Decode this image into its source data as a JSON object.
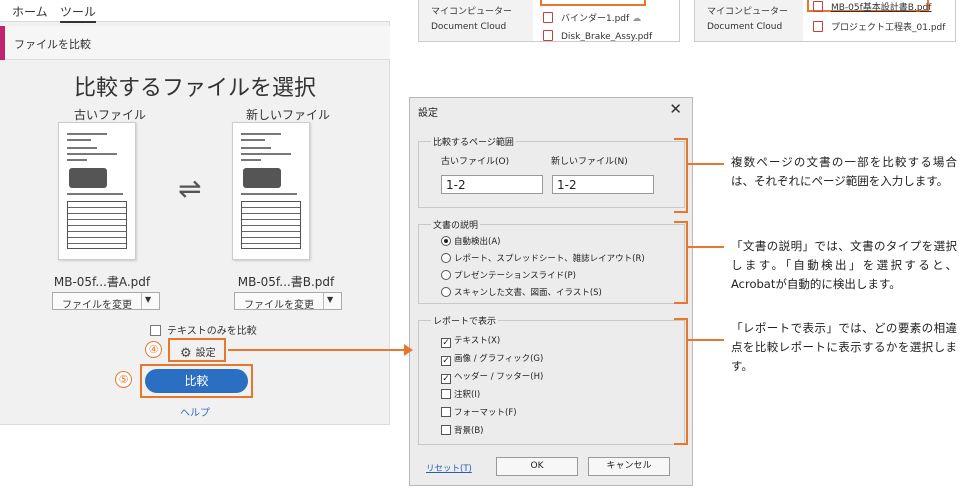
{
  "top_tabs": {
    "home": "ホーム",
    "tools": "ツール"
  },
  "tool_header": {
    "title": "ファイルを比較",
    "accent_color": "#c1246e"
  },
  "compare_panel": {
    "title": "比較するファイルを選択",
    "old_file": {
      "label": "古いファイル",
      "name": "MB-05f...書A.pdf",
      "change_button": "ファイルを変更"
    },
    "new_file": {
      "label": "新しいファイル",
      "name": "MB-05f...書B.pdf",
      "change_button": "ファイルを変更"
    },
    "swap_glyph": "⇌",
    "text_only_checkbox": "テキストのみを比較",
    "settings_button": "設定",
    "compare_button": "比較",
    "help_link": "ヘルプ",
    "step_numbers": [
      "④",
      "⑤"
    ],
    "button_color": "#2a6fc1",
    "highlight_color": "#e8772e"
  },
  "snippet_left": {
    "nav_items": [
      "マイコンピューター",
      "Document Cloud"
    ],
    "files": [
      "バインダー1.pdf",
      "Disk_Brake_Assy.pdf"
    ]
  },
  "snippet_right": {
    "nav_items": [
      "マイコンピューター",
      "Document Cloud"
    ],
    "files": [
      "MB-05f基本設計書B.pdf",
      "プロジェクト工程表_01.pdf"
    ]
  },
  "dialog": {
    "title": "設定",
    "close": "✕",
    "page_range": {
      "group_label": "比較するページ範囲",
      "old_label": "古いファイル(O)",
      "new_label": "新しいファイル(N)",
      "old_value": "1-2",
      "new_value": "1-2"
    },
    "doc_description": {
      "group_label": "文書の説明",
      "options": [
        "自動検出(A)",
        "レポート、スプレッドシート、雑誌レイアウト(R)",
        "プレゼンテーションスライド(P)",
        "スキャンした文書、図面、イラスト(S)"
      ],
      "selected": "自動検出(A)"
    },
    "report_display": {
      "group_label": "レポートで表示",
      "options": [
        "テキスト(X)",
        "画像 / グラフィック(G)",
        "ヘッダー / フッター(H)",
        "注釈(I)",
        "フォーマット(F)",
        "背景(B)"
      ],
      "checked": [
        "テキスト(X)",
        "画像 / グラフィック(G)",
        "ヘッダー / フッター(H)"
      ]
    },
    "reset_link": "リセット(T)",
    "ok_button": "OK",
    "cancel_button": "キャンセル"
  },
  "annotations": [
    "複数ページの文書の一部を比較する場合は、それぞれにページ範囲を入力します。",
    "「文書の説明」では、文書のタイプを選択します。「自動検出」を選択すると、Acrobatが自動的に検出します。",
    "「レポートで表示」では、どの要素の相違点を比較レポートに表示するかを選択します。"
  ]
}
